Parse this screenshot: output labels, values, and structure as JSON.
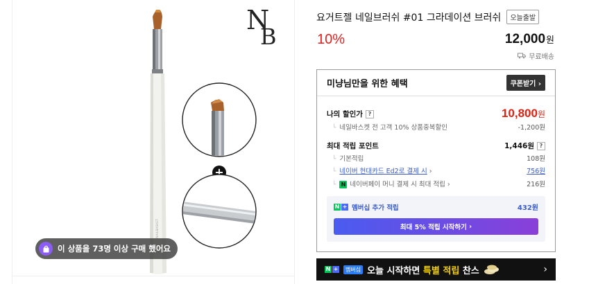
{
  "product": {
    "title": "요거트젤 네일브러쉬 #01 그라데이션 브러쉬",
    "tag": "오늘출발",
    "discount": "10%",
    "price": "12,000",
    "currency": "원",
    "shipping": "무료배송",
    "buy_badge": "이 상품을 73명 이상 구매 했어요",
    "logo_text": "nailbasket",
    "logo_letters": "NB"
  },
  "benefit": {
    "title": "미냥님만을 위한 혜택",
    "coupon_button": "쿠폰받기",
    "my_discount_label": "나의 할인가",
    "my_discount_value": "10,800",
    "my_discount_currency": "원",
    "discount_detail_label": "네일바스켓 전 고객 10% 상품중복할인",
    "discount_detail_value": "-1,200원",
    "points_label": "최대 적립 포인트",
    "points_value": "1,446원",
    "basic_label": "기본적립",
    "basic_value": "108원",
    "card_label": "네이버 현대카드 Ed2로 결제 시",
    "card_value": "756원",
    "npay_label": "네이버페이 머니 결제 시 최대 적립",
    "npay_value": "216원",
    "membership_label": "멤버십 추가 적립",
    "membership_value": "432원",
    "membership_button": "최대 5% 적립 시작하기"
  },
  "banner": {
    "badge": "멤버십",
    "text_before": "오늘 시작하면",
    "text_highlight": "특별 적립",
    "text_after": "찬스"
  }
}
